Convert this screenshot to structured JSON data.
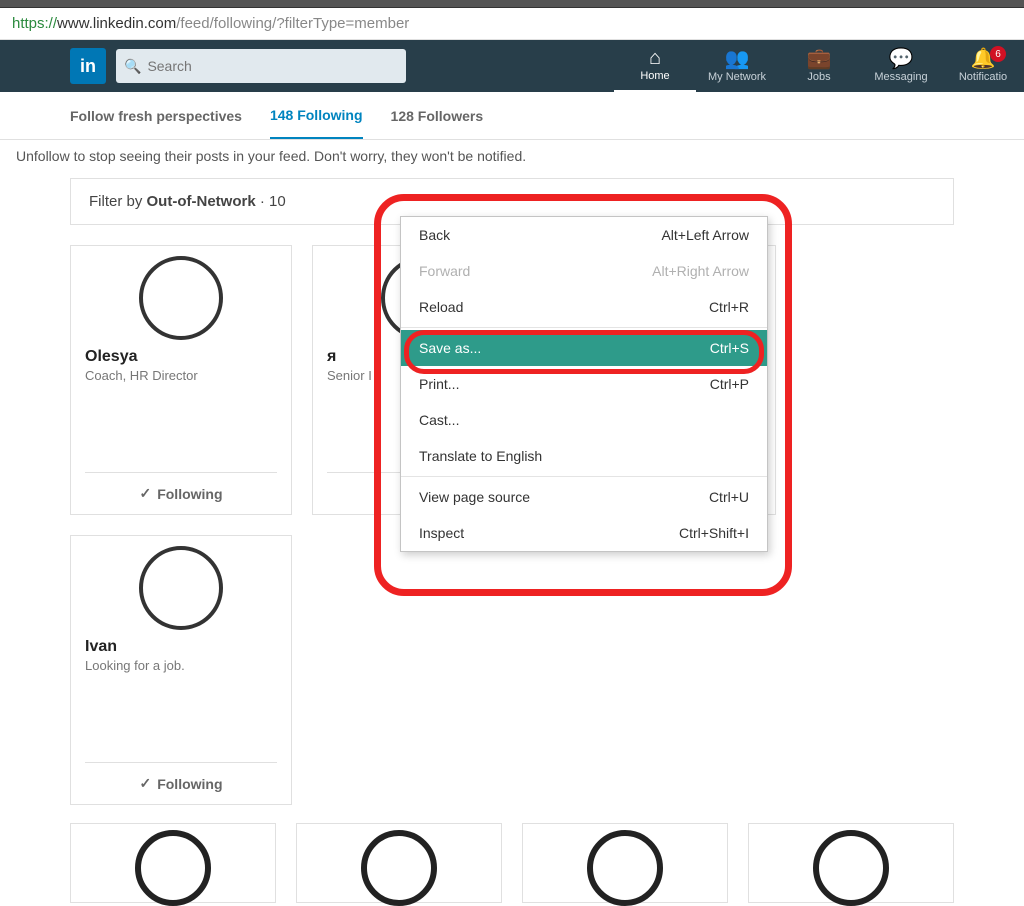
{
  "url": {
    "proto": "https://",
    "host": "www.linkedin.com",
    "path": "/feed/following/?filterType=member"
  },
  "search": {
    "placeholder": "Search"
  },
  "nav": {
    "home": "Home",
    "network": "My Network",
    "jobs": "Jobs",
    "messaging": "Messaging",
    "notifications": "Notificatio",
    "badge": "6"
  },
  "tabs": {
    "fresh": "Follow fresh perspectives",
    "following": "148 Following",
    "followers": "128 Followers"
  },
  "notice": "Unfollow to stop seeing their posts in your feed. Don't worry, they won't be notified.",
  "filter": {
    "prefix": "Filter by ",
    "name": "Out-of-Network",
    "count": " · 10"
  },
  "cards": [
    {
      "name": "Olesya",
      "tag": "Coach, HR Director",
      "btn": "Following"
    },
    {
      "name": "я",
      "tag": "Senior I",
      "btn": ""
    },
    {
      "name": "",
      "tag": "",
      "btn": ""
    },
    {
      "name": "Ivan",
      "tag": "Looking for a job.",
      "btn": "Following"
    }
  ],
  "contextMenu": {
    "back": {
      "label": "Back",
      "shortcut": "Alt+Left Arrow"
    },
    "forward": {
      "label": "Forward",
      "shortcut": "Alt+Right Arrow"
    },
    "reload": {
      "label": "Reload",
      "shortcut": "Ctrl+R"
    },
    "saveas": {
      "label": "Save as...",
      "shortcut": "Ctrl+S"
    },
    "print": {
      "label": "Print...",
      "shortcut": "Ctrl+P"
    },
    "cast": {
      "label": "Cast..."
    },
    "translate": {
      "label": "Translate to English"
    },
    "viewsource": {
      "label": "View page source",
      "shortcut": "Ctrl+U"
    },
    "inspect": {
      "label": "Inspect",
      "shortcut": "Ctrl+Shift+I"
    }
  }
}
